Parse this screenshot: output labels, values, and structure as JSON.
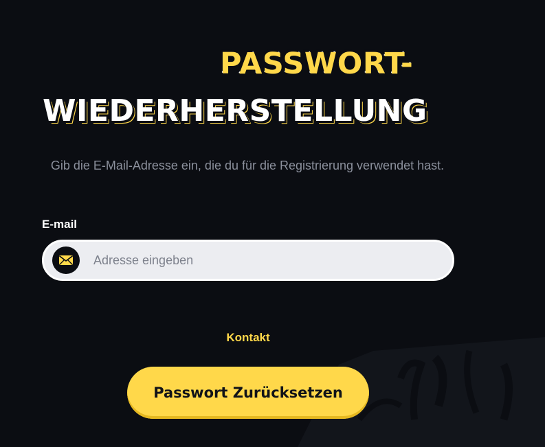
{
  "colors": {
    "background": "#0b0d12",
    "accent": "#ffd84a",
    "input_background": "#ecedf1"
  },
  "header": {
    "title_line1": "PASSWORT-",
    "title_line2": "WIEDERHERSTELLUNG",
    "subtitle": "Gib die E-Mail-Adresse ein, die du für die Registrierung verwendet hast."
  },
  "form": {
    "email_label": "E-mail",
    "email_icon": "envelope-icon",
    "email_placeholder": "Adresse eingeben",
    "email_value": "",
    "contact_label": "Kontakt",
    "submit_label": "Passwort Zurücksetzen"
  }
}
